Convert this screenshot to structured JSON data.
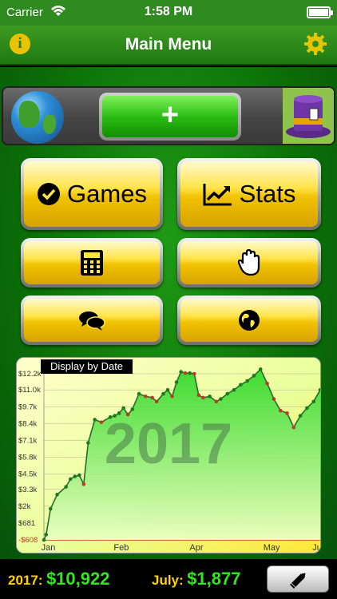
{
  "status": {
    "carrier": "Carrier",
    "time": "1:58 PM"
  },
  "nav": {
    "title": "Main Menu",
    "info_icon": "info-icon",
    "settings_icon": "gear-icon",
    "info_glyph": "i"
  },
  "top_row": {
    "plus_label": "+",
    "left_icon": "globe-icon",
    "right_icon": "magic-hat-icon"
  },
  "menu": {
    "games_label": "Games",
    "stats_label": "Stats",
    "games_icon": "checkmark-circle-icon",
    "stats_icon": "trend-chart-icon",
    "calc_icon": "calculator-icon",
    "hand_icon": "hand-icon",
    "chat_icon": "chat-bubbles-icon",
    "world_icon": "world-icon"
  },
  "chart_data": {
    "type": "line",
    "tag": "Display by Date",
    "watermark": "2017",
    "y_ticks": [
      "$12.2k",
      "$11.0k",
      "$9.7k",
      "$8.4k",
      "$7.1k",
      "$5.8k",
      "$4.5k",
      "$3.3k",
      "$2k",
      "$681",
      "-$608"
    ],
    "y_tick_values": [
      12250,
      11000,
      9700,
      8400,
      7100,
      5800,
      4500,
      3300,
      2000,
      681,
      -608
    ],
    "x_ticks": [
      "Jan",
      "Feb",
      "Apr",
      "May",
      "Jul"
    ],
    "ylim": [
      -608,
      12250
    ],
    "x": [
      0.0,
      0.1,
      0.3,
      0.6,
      1.0,
      1.2,
      1.4,
      1.6,
      1.8,
      2.0,
      2.3,
      2.6,
      3.0,
      3.2,
      3.4,
      3.6,
      3.8,
      4.0,
      4.3,
      4.6,
      4.9,
      5.1,
      5.4,
      5.6,
      5.8,
      6.0,
      6.2,
      6.4,
      6.6,
      6.8,
      7.0,
      7.2,
      7.5,
      7.8,
      8.0,
      8.3,
      8.6,
      8.9,
      9.2,
      9.5,
      9.8,
      10.1,
      10.4,
      10.7,
      11.0,
      11.3,
      11.6,
      11.9,
      12.2,
      12.5
    ],
    "values": [
      -608,
      -200,
      1800,
      2900,
      3500,
      4100,
      4300,
      4400,
      3700,
      6900,
      8700,
      8500,
      8900,
      9000,
      9200,
      9600,
      9100,
      9500,
      10700,
      10500,
      10400,
      10100,
      10700,
      11000,
      10500,
      11600,
      12400,
      12300,
      12300,
      12250,
      10600,
      10400,
      10500,
      10100,
      10300,
      10700,
      11000,
      11400,
      11700,
      12100,
      12600,
      11500,
      10300,
      9400,
      9200,
      8100,
      9000,
      9600,
      10100,
      11000
    ],
    "profit_color": "#22c31a",
    "loss_color": "#c0392b"
  },
  "bottom": {
    "year_label": "2017:",
    "year_total": "$10,922",
    "month_label": "July:",
    "month_total": "$1,877",
    "edit_icon": "pencil-icon"
  }
}
